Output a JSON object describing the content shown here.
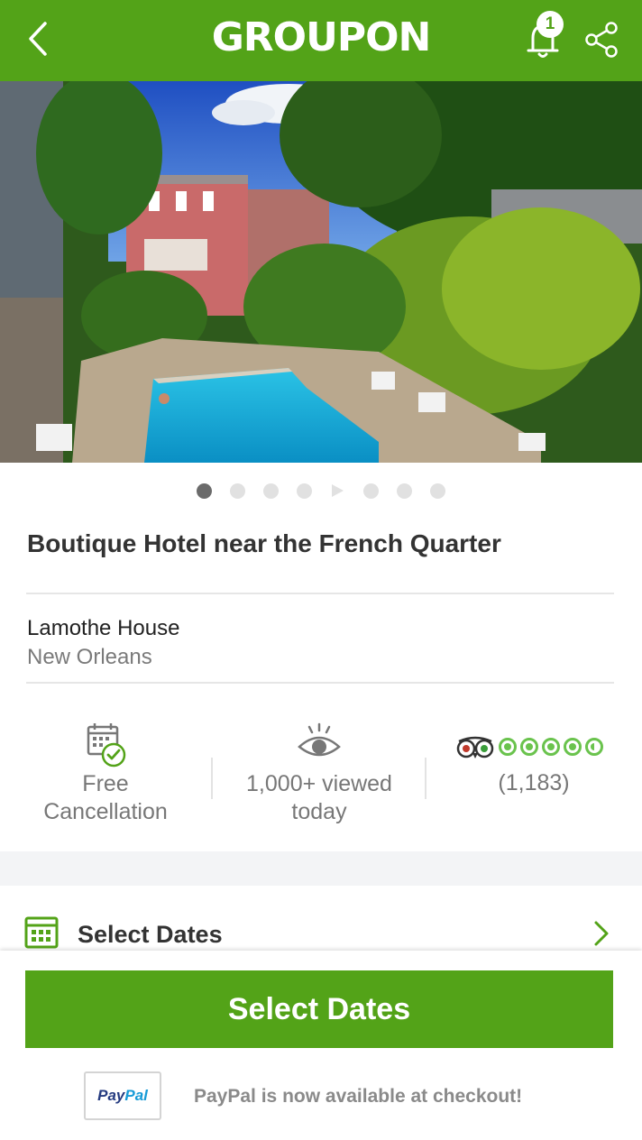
{
  "header": {
    "logo_text": "GROUPON",
    "notification_count": "1",
    "brand_color": "#53a318"
  },
  "gallery": {
    "photo_count": 8,
    "active_index": 0,
    "video_index": 4
  },
  "deal": {
    "title": "Boutique Hotel near the French Quarter",
    "merchant": "Lamothe House",
    "location": "New Orleans"
  },
  "features": {
    "cancellation_line1": "Free",
    "cancellation_line2": "Cancellation",
    "views_line1": "1,000+ viewed",
    "views_line2": "today",
    "rating_bubbles": 4.5,
    "review_count": "(1,183)"
  },
  "dates_section": {
    "label": "Select Dates"
  },
  "bottom": {
    "cta_label": "Select Dates",
    "paypal_pay": "Pay",
    "paypal_pal": "Pal",
    "paypal_message": "PayPal is now available at checkout!"
  },
  "icons": {
    "back": "chevron-left-icon",
    "bell": "bell-icon",
    "share": "share-icon",
    "calendar_check": "calendar-check-icon",
    "eye": "eye-icon",
    "tripadvisor": "tripadvisor-owl-icon",
    "calendar": "calendar-icon",
    "chevron": "chevron-right-icon"
  }
}
